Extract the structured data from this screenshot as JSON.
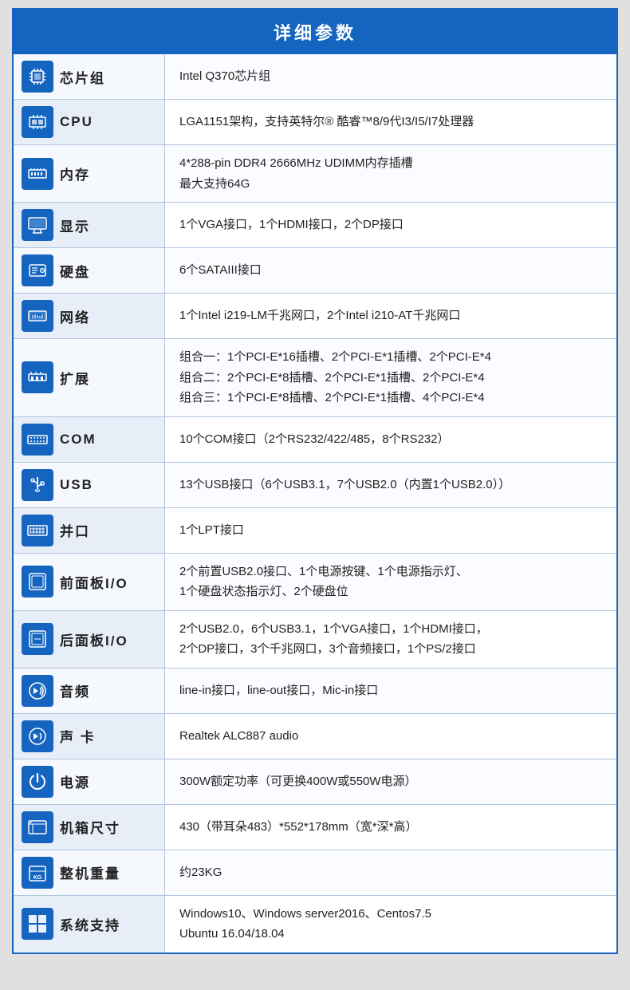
{
  "title": "详细参数",
  "rows": [
    {
      "id": "chipset",
      "label": "芯片组",
      "value": "Intel Q370芯片组",
      "icon": "chipset"
    },
    {
      "id": "cpu",
      "label": "CPU",
      "value": "LGA1151架构，支持英特尔® 酷睿™8/9代I3/I5/I7处理器",
      "icon": "cpu"
    },
    {
      "id": "memory",
      "label": "内存",
      "value": "4*288-pin DDR4 2666MHz  UDIMM内存插槽\n最大支持64G",
      "icon": "memory"
    },
    {
      "id": "display",
      "label": "显示",
      "value": "1个VGA接口，1个HDMI接口，2个DP接口",
      "icon": "display"
    },
    {
      "id": "harddisk",
      "label": "硬盘",
      "value": "6个SATAIII接口",
      "icon": "harddisk"
    },
    {
      "id": "network",
      "label": "网络",
      "value": "1个Intel i219-LM千兆网口，2个Intel i210-AT千兆网口",
      "icon": "network"
    },
    {
      "id": "expansion",
      "label": "扩展",
      "value": "组合一：1个PCI-E*16插槽、2个PCI-E*1插槽、2个PCI-E*4\n组合二：2个PCI-E*8插槽、2个PCI-E*1插槽、2个PCI-E*4\n组合三：1个PCI-E*8插槽、2个PCI-E*1插槽、4个PCI-E*4",
      "icon": "expansion"
    },
    {
      "id": "com",
      "label": "COM",
      "value": "10个COM接口（2个RS232/422/485，8个RS232）",
      "icon": "com"
    },
    {
      "id": "usb",
      "label": "USB",
      "value": "13个USB接口（6个USB3.1，7个USB2.0（内置1个USB2.0））",
      "icon": "usb"
    },
    {
      "id": "parallel",
      "label": "并口",
      "value": "1个LPT接口",
      "icon": "parallel"
    },
    {
      "id": "front-io",
      "label": "前面板I/O",
      "value": "2个前置USB2.0接口、1个电源按键、1个电源指示灯、\n1个硬盘状态指示灯、2个硬盘位",
      "icon": "front-io"
    },
    {
      "id": "rear-io",
      "label": "后面板I/O",
      "value": "2个USB2.0，6个USB3.1，1个VGA接口，1个HDMI接口，\n2个DP接口，3个千兆网口，3个音频接口，1个PS/2接口",
      "icon": "rear-io"
    },
    {
      "id": "audio",
      "label": "音频",
      "value": "line-in接口，line-out接口，Mic-in接口",
      "icon": "audio"
    },
    {
      "id": "soundcard",
      "label": "声 卡",
      "value": "Realtek  ALC887 audio",
      "icon": "soundcard"
    },
    {
      "id": "power",
      "label": "电源",
      "value": "300W额定功率（可更换400W或550W电源）",
      "icon": "power"
    },
    {
      "id": "chassis",
      "label": "机箱尺寸",
      "value": "430（带耳朵483）*552*178mm（宽*深*高）",
      "icon": "chassis"
    },
    {
      "id": "weight",
      "label": "整机重量",
      "value": "约23KG",
      "icon": "weight"
    },
    {
      "id": "os",
      "label": "系统支持",
      "value": "Windows10、Windows server2016、Centos7.5\nUbuntu 16.04/18.04",
      "icon": "os"
    }
  ]
}
